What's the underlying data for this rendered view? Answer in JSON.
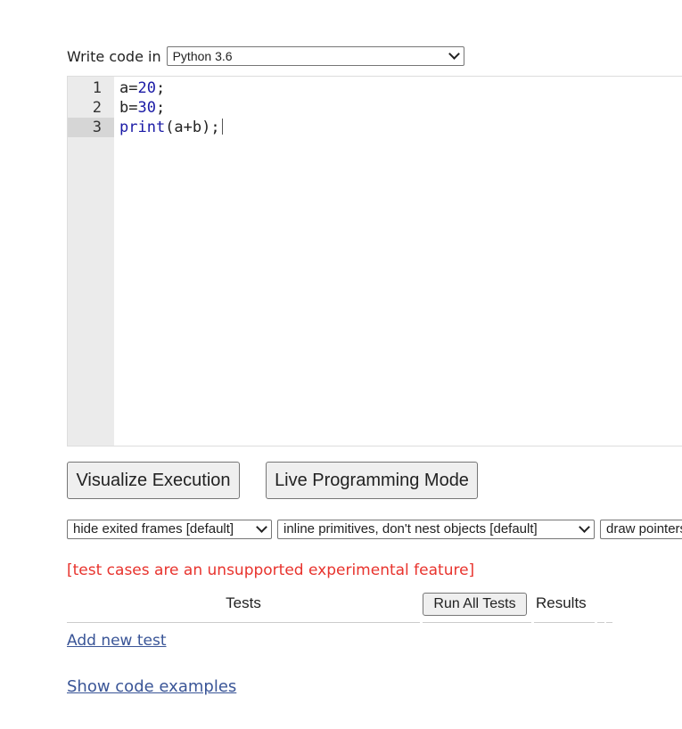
{
  "language": {
    "label": "Write code in",
    "selected": "Python 3.6"
  },
  "editor": {
    "line_numbers": [
      "1",
      "2",
      "3"
    ],
    "active_line": 3,
    "lines": [
      {
        "before": "a=",
        "num": "20",
        "after": ";"
      },
      {
        "before": "b=",
        "num": "30",
        "after": ";"
      },
      {
        "fn": "print",
        "rest": "(a+b);"
      }
    ]
  },
  "buttons": {
    "visualize": "Visualize Execution",
    "live": "Live Programming Mode"
  },
  "options": {
    "frames": "hide exited frames [default]",
    "primitives": "inline primitives, don't nest objects [default]",
    "pointers": "draw pointers as arrows [default]"
  },
  "tests": {
    "warning": "[test cases are an unsupported experimental feature]",
    "tests_header": "Tests",
    "run_all": "Run All Tests",
    "results_header": "Results",
    "add_new": "Add new test"
  },
  "footer": {
    "show_examples": "Show code examples"
  },
  "colors": {
    "warning": "#e8332d",
    "link": "#3a5597",
    "code_token": "#1a1aa6"
  }
}
